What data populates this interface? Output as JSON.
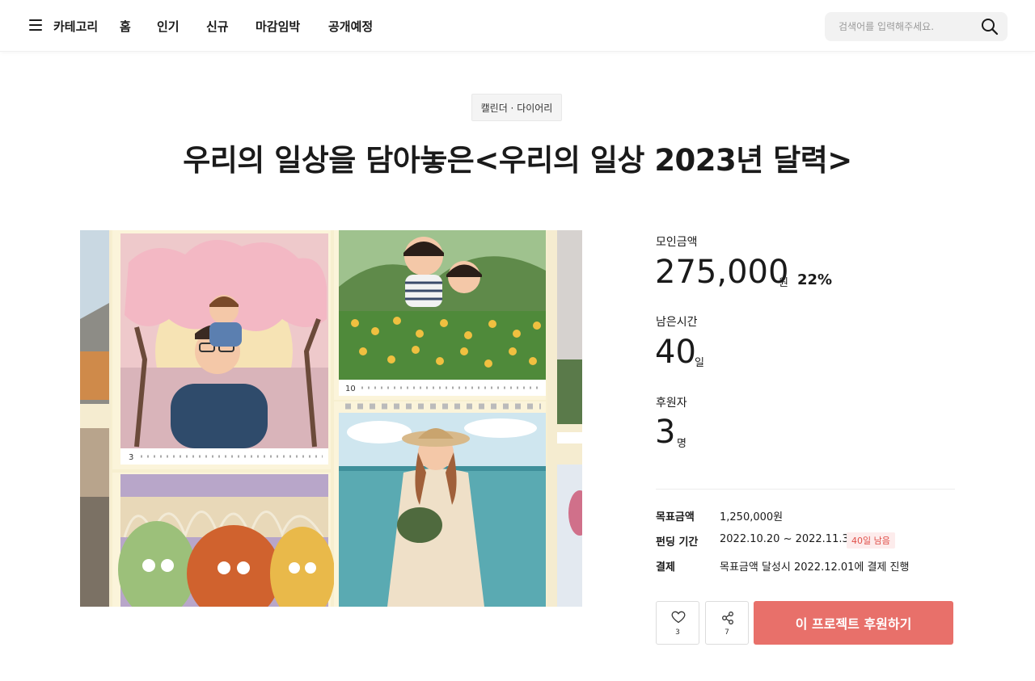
{
  "header": {
    "menu_label": "카테고리",
    "nav": [
      "홈",
      "인기",
      "신규",
      "마감임박",
      "공개예정"
    ],
    "search_placeholder": "검색어를 입력해주세요."
  },
  "project": {
    "category": "캘린더 · 다이어리",
    "title": "우리의 일상을 담아놓은<우리의 일상 2023년 달력>"
  },
  "stats": {
    "raised_label": "모인금액",
    "raised_amount": "275,000",
    "raised_unit": "원",
    "raised_percent": "22%",
    "remaining_label": "남은시간",
    "remaining_value": "40",
    "remaining_unit": "일",
    "backers_label": "후원자",
    "backers_value": "3",
    "backers_unit": "명"
  },
  "info": {
    "goal_label": "목표금액",
    "goal_value": "1,250,000원",
    "period_label": "펀딩 기간",
    "period_value": "2022.10.20 ~ 2022.11.30",
    "days_left_badge": "40일 남음",
    "payment_label": "결제",
    "payment_value": "목표금액 달성시 2022.12.01에 결제 진행"
  },
  "artwork": {
    "march_label": "3",
    "october_label": "10"
  },
  "actions": {
    "like_count": "3",
    "share_count": "7",
    "back_label": "이 프로젝트 후원하기"
  },
  "colors": {
    "accent": "#e8706a",
    "badge_bg": "#fdecec",
    "badge_text": "#e0504a"
  }
}
